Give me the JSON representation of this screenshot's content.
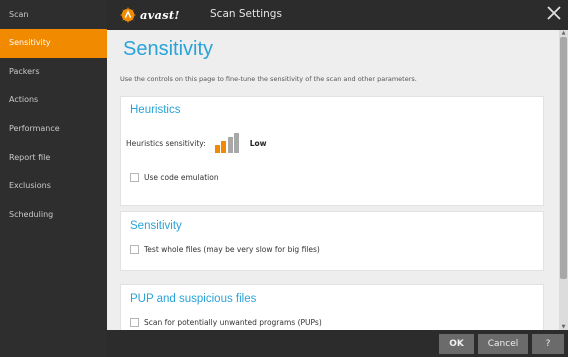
{
  "window": {
    "brand": "avast!",
    "title": "Scan Settings"
  },
  "sidebar": {
    "items": [
      {
        "label": "Scan",
        "active": false
      },
      {
        "label": "Sensitivity",
        "active": true
      },
      {
        "label": "Packers",
        "active": false
      },
      {
        "label": "Actions",
        "active": false
      },
      {
        "label": "Performance",
        "active": false
      },
      {
        "label": "Report file",
        "active": false
      },
      {
        "label": "Exclusions",
        "active": false
      },
      {
        "label": "Scheduling",
        "active": false
      }
    ]
  },
  "main": {
    "title": "Sensitivity",
    "intro": "Use the controls on this page to fine-tune the sensitivity of the scan and other parameters.",
    "heuristics": {
      "heading": "Heuristics",
      "sensitivity_label": "Heuristics sensitivity:",
      "sensitivity_value": "Low",
      "level": 2,
      "levels_total": 4,
      "code_emulation_label": "Use code emulation",
      "code_emulation_checked": false
    },
    "sensitivity": {
      "heading": "Sensitivity",
      "whole_files_label": "Test whole files (may be very slow for big files)",
      "whole_files_checked": false
    },
    "pup": {
      "heading": "PUP and suspicious files",
      "pup_label": "Scan for potentially unwanted programs (PUPs)",
      "pup_checked": false
    }
  },
  "footer": {
    "ok_label": "OK",
    "cancel_label": "Cancel",
    "help_label": "?"
  },
  "colors": {
    "accent_orange": "#f28a00",
    "title_blue": "#29a3d8",
    "bar_inactive": "#a8a8a8"
  }
}
